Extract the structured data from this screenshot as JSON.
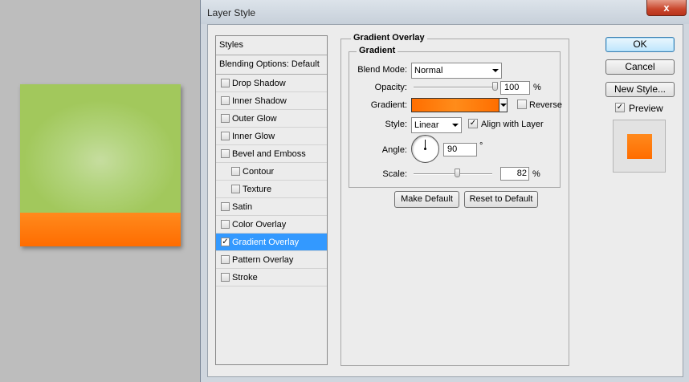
{
  "dialog": {
    "title": "Layer Style",
    "close_label": "x"
  },
  "styles_list": {
    "header": "Styles",
    "blending_options": "Blending Options: Default",
    "items": [
      {
        "label": "Drop Shadow",
        "checked": false,
        "sub": false,
        "selected": false
      },
      {
        "label": "Inner Shadow",
        "checked": false,
        "sub": false,
        "selected": false
      },
      {
        "label": "Outer Glow",
        "checked": false,
        "sub": false,
        "selected": false
      },
      {
        "label": "Inner Glow",
        "checked": false,
        "sub": false,
        "selected": false
      },
      {
        "label": "Bevel and Emboss",
        "checked": false,
        "sub": false,
        "selected": false
      },
      {
        "label": "Contour",
        "checked": false,
        "sub": true,
        "selected": false
      },
      {
        "label": "Texture",
        "checked": false,
        "sub": true,
        "selected": false
      },
      {
        "label": "Satin",
        "checked": false,
        "sub": false,
        "selected": false
      },
      {
        "label": "Color Overlay",
        "checked": false,
        "sub": false,
        "selected": false
      },
      {
        "label": "Gradient Overlay",
        "checked": true,
        "sub": false,
        "selected": true
      },
      {
        "label": "Pattern Overlay",
        "checked": false,
        "sub": false,
        "selected": false
      },
      {
        "label": "Stroke",
        "checked": false,
        "sub": false,
        "selected": false
      }
    ]
  },
  "panel": {
    "section_title": "Gradient Overlay",
    "group_title": "Gradient",
    "blend_mode_label": "Blend Mode:",
    "blend_mode_value": "Normal",
    "opacity_label": "Opacity:",
    "opacity_value": "100",
    "opacity_unit": "%",
    "opacity_level": 1.0,
    "gradient_label": "Gradient:",
    "gradient_colors": [
      "#ff6e00",
      "#ff8c1a"
    ],
    "reverse_label": "Reverse",
    "reverse_checked": false,
    "style_label": "Style:",
    "style_value": "Linear",
    "align_label": "Align with Layer",
    "align_checked": true,
    "angle_label": "Angle:",
    "angle_value": "90",
    "angle_unit": "°",
    "scale_label": "Scale:",
    "scale_value": "82",
    "scale_unit": "%",
    "scale_level": 0.82,
    "make_default_label": "Make Default",
    "reset_default_label": "Reset to Default"
  },
  "actions": {
    "ok_label": "OK",
    "cancel_label": "Cancel",
    "new_style_label": "New Style...",
    "preview_label": "Preview",
    "preview_checked": true
  },
  "colors": {
    "selection": "#3399ff",
    "orange": "#ff7a0a",
    "green": "#a2c85c"
  }
}
